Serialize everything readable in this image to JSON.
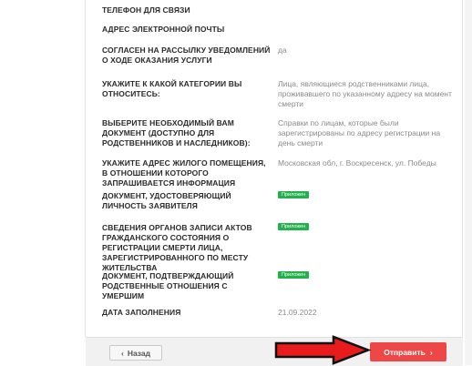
{
  "fields": [
    {
      "label": "ТЕЛЕФОН ДЛЯ СВЯЗИ",
      "value": ""
    },
    {
      "label": "АДРЕС ЭЛЕКТРОННОЙ ПОЧТЫ",
      "value": ""
    },
    {
      "label": "СОГЛАСЕН НА РАССЫЛКУ УВЕДОМЛЕНИЙ О ХОДЕ ОКАЗАНИЯ УСЛУГИ",
      "value": "да"
    },
    {
      "label": "УКАЖИТЕ К КАКОЙ КАТЕГОРИИ ВЫ ОТНОСИТЕСЬ:",
      "value": "Лица, являющиеся родственниками лица, проживавшего по указанному адресу на момент смерти"
    },
    {
      "label": "ВЫБЕРИТЕ НЕОБХОДИМЫЙ ВАМ ДОКУМЕНТ (ДОСТУПНО ДЛЯ РОДСТВЕННИКОВ И НАСЛЕДНИКОВ):",
      "value": "Справки по лицам, которые были зарегистрированы по адресу регистрации на день смерти"
    },
    {
      "label": "УКАЖИТЕ АДРЕС ЖИЛОГО ПОМЕЩЕНИЯ, В ОТНОШЕНИИ КОТОРОГО ЗАПРАШИВАЕТСЯ ИНФОРМАЦИЯ",
      "value": "Московская обл, г. Воскресенск, ул. Победы"
    },
    {
      "label": "ДОКУМЕНТ, УДОСТОВЕРЯЮЩИЙ ЛИЧНОСТЬ ЗАЯВИТЕЛЯ",
      "badge": "Приложен"
    },
    {
      "label": "СВЕДЕНИЯ ОРГАНОВ ЗАПИСИ АКТОВ ГРАЖДАНСКОГО СОСТОЯНИЯ О РЕГИСТРАЦИИ СМЕРТИ ЛИЦА, ЗАРЕГИСТРИРОВАННОГО ПО МЕСТУ ЖИТЕЛЬСТВА",
      "badge": "Приложен"
    },
    {
      "label": "ДОКУМЕНТ, ПОДТВЕРЖДАЮЩИЙ РОДСТВЕННЫЕ ОТНОШЕНИЯ С УМЕРШИМ",
      "badge": "Приложен"
    },
    {
      "label": "ДАТА ЗАПОЛНЕНИЯ",
      "value": "21.09.2022"
    }
  ],
  "footer": {
    "back_label": "Назад",
    "submit_label": "Отправить"
  },
  "colors": {
    "accent": "#ee4747",
    "badge": "#23b14d",
    "arrow": "#e81c1c"
  }
}
